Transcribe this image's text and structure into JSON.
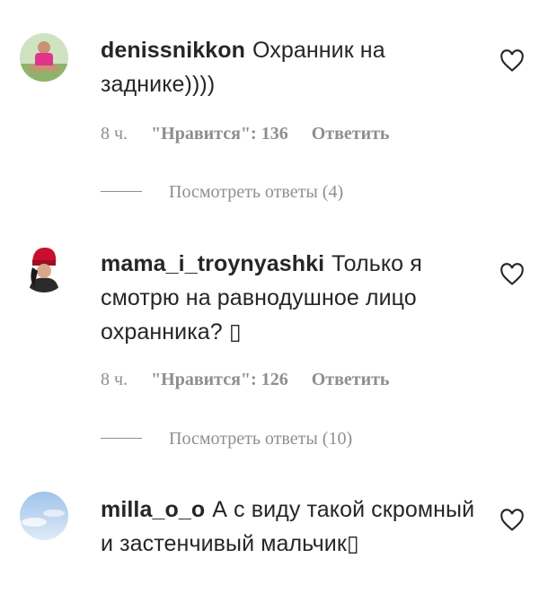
{
  "comments": [
    {
      "username": "denissnikkon",
      "text": "Охранник на заднике))))",
      "time": "8 ч.",
      "likes": "\"Нравится\": 136",
      "reply_label": "Ответить",
      "view_replies": "Посмотреть ответы (4)",
      "avatar_colors": [
        "#8fb36a",
        "#e0338a"
      ]
    },
    {
      "username": "mama_i_troynyashki",
      "text": "Только я смотрю на равнодушное лицо охранника? ▯",
      "time": "8 ч.",
      "likes": "\"Нравится\": 126",
      "reply_label": "Ответить",
      "view_replies": "Посмотреть ответы (10)",
      "avatar_colors": [
        "#c8102e",
        "#2b2b2b"
      ]
    },
    {
      "username": "milla_o_o",
      "text": "А с виду такой скромный и застенчивый мальчик▯",
      "avatar_colors": [
        "#9fc3ea",
        "#dfeaf7"
      ]
    }
  ]
}
